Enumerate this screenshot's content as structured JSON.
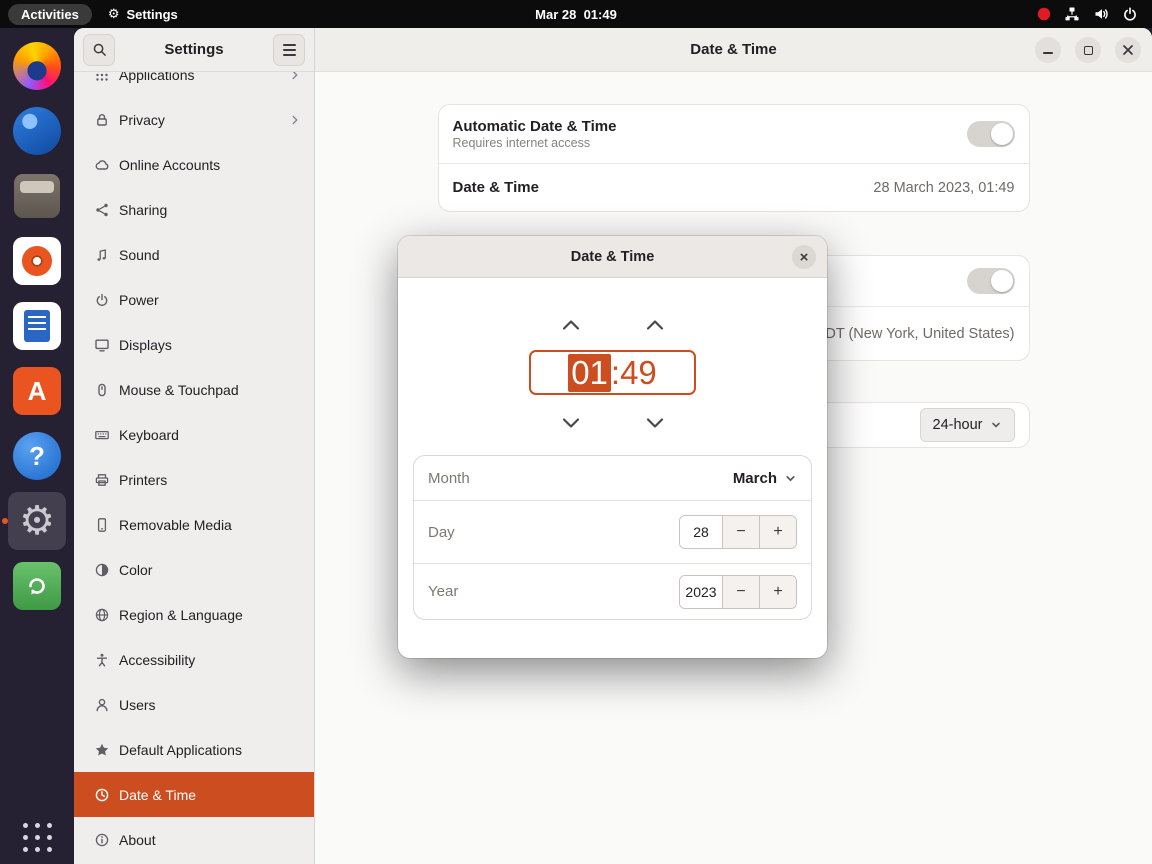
{
  "colors": {
    "accent": "#cc4d1f",
    "topbar": "#0c0c0c",
    "dock": "#262033",
    "sidebar": "#f0eeec",
    "content": "#fafaf9",
    "headerbar": "#f0eeeb",
    "card": "#ffffff",
    "dialog": "#ffffff",
    "text": "#232025"
  },
  "topbar": {
    "activities": "Activities",
    "app_name": "Settings",
    "clock": "Mar 28  01:49"
  },
  "icons": {
    "search": "magnifier",
    "menu": "hamburger",
    "minimize": "horizontal-line",
    "maximize": "square-outline",
    "close": "cross",
    "dropdown": "chevron-down",
    "gear_glyph": "⚙"
  },
  "dock": {
    "items": [
      {
        "name": "firefox"
      },
      {
        "name": "thunderbird"
      },
      {
        "name": "files"
      },
      {
        "name": "rhythmbox"
      },
      {
        "name": "libreoffice-writer"
      },
      {
        "name": "ubuntu-software",
        "letter": "A"
      },
      {
        "name": "help",
        "letter": "?"
      },
      {
        "name": "settings",
        "active": true
      },
      {
        "name": "software-updater"
      }
    ]
  },
  "sidebar": {
    "title": "Settings",
    "items": [
      {
        "label": "Applications",
        "icon": "apps-grid",
        "chevron": true
      },
      {
        "label": "Privacy",
        "icon": "lock",
        "chevron": true
      },
      {
        "label": "Online Accounts",
        "icon": "cloud"
      },
      {
        "label": "Sharing",
        "icon": "share"
      },
      {
        "label": "Sound",
        "icon": "music-note"
      },
      {
        "label": "Power",
        "icon": "power"
      },
      {
        "label": "Displays",
        "icon": "display"
      },
      {
        "label": "Mouse & Touchpad",
        "icon": "mouse"
      },
      {
        "label": "Keyboard",
        "icon": "keyboard"
      },
      {
        "label": "Printers",
        "icon": "printer"
      },
      {
        "label": "Removable Media",
        "icon": "removable-media"
      },
      {
        "label": "Color",
        "icon": "color"
      },
      {
        "label": "Region & Language",
        "icon": "globe"
      },
      {
        "label": "Accessibility",
        "icon": "accessibility"
      },
      {
        "label": "Users",
        "icon": "user"
      },
      {
        "label": "Default Applications",
        "icon": "star"
      },
      {
        "label": "Date & Time",
        "icon": "clock",
        "selected": true
      },
      {
        "label": "About",
        "icon": "info"
      }
    ]
  },
  "header": {
    "title": "Date & Time"
  },
  "panel": {
    "auto": {
      "title": "Automatic Date & Time",
      "subtitle": "Requires internet access",
      "on": true
    },
    "datetime": {
      "label": "Date & Time",
      "value": "28 March 2023, 01:49"
    },
    "timezone": {
      "auto_on": true,
      "value": "DT (New York, United States)"
    },
    "time_format": {
      "value": "24-hour"
    }
  },
  "dialog": {
    "title": "Date & Time",
    "time": {
      "hours": "01",
      "separator": ":",
      "minutes": "49"
    },
    "month": {
      "label": "Month",
      "value": "March"
    },
    "day": {
      "label": "Day",
      "value": "28"
    },
    "year": {
      "label": "Year",
      "value": "2023"
    },
    "controls": {
      "minus": "−",
      "plus": "+",
      "close": "×"
    }
  }
}
